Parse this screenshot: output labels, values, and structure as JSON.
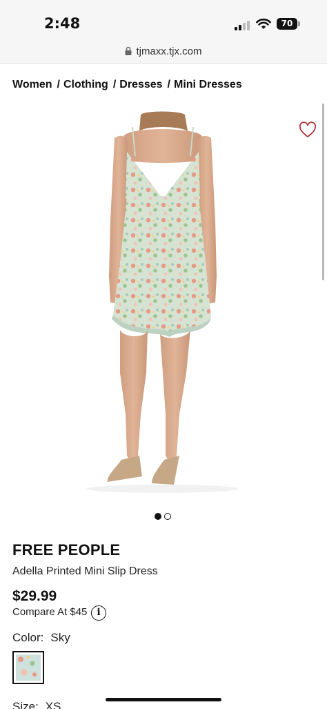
{
  "status_bar": {
    "time": "2:48",
    "battery": "70"
  },
  "browser": {
    "url": "tjmaxx.tjx.com"
  },
  "breadcrumb": [
    "Women",
    "Clothing",
    "Dresses",
    "Mini Dresses"
  ],
  "product": {
    "brand": "FREE PEOPLE",
    "name": "Adella Printed Mini Slip Dress",
    "price": "$29.99",
    "compare_at": "Compare At $45",
    "color_label": "Color:",
    "color_value": "Sky",
    "size_label": "Size:",
    "size_value": "XS"
  },
  "carousel": {
    "total": 2,
    "active_index": 0
  },
  "icons": {
    "wishlist": "heart-icon",
    "info": "info-icon",
    "lock": "lock-icon"
  },
  "colors": {
    "heart": "#b3333a",
    "dress_base": "#d6e2d2"
  }
}
